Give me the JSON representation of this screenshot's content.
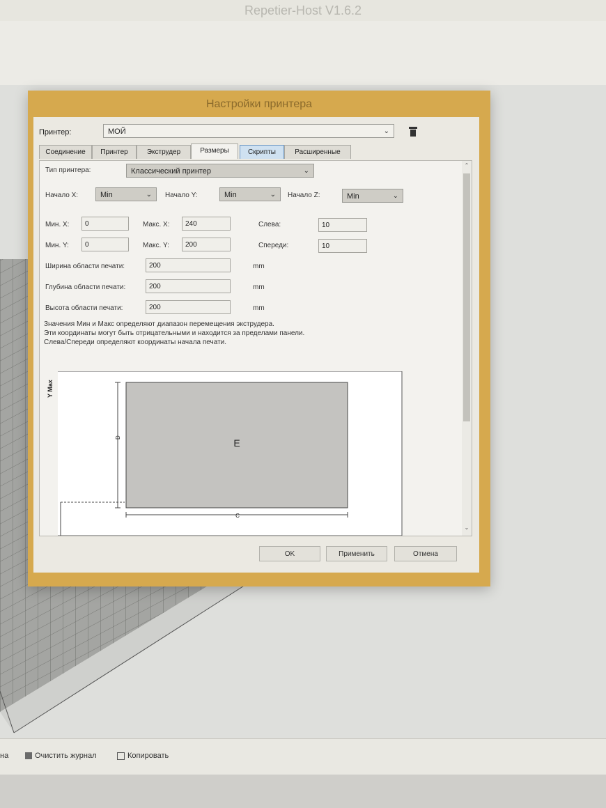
{
  "app": {
    "title": "Repetier-Host V1.6.2"
  },
  "dialog": {
    "title": "Настройки принтера",
    "printer_label": "Принтер:",
    "printer_value": "МОЙ",
    "tabs": [
      "Соединение",
      "Принтер",
      "Экструдер",
      "Размеры",
      "Скрипты",
      "Расширенные"
    ],
    "active_tab": "Размеры",
    "printer_type_label": "Тип принтера:",
    "printer_type_value": "Классический принтер",
    "start_x_label": "Начало X:",
    "start_x_value": "Min",
    "start_y_label": "Начало Y:",
    "start_y_value": "Min",
    "start_z_label": "Начало Z:",
    "start_z_value": "Min",
    "min_x_label": "Мин. X:",
    "min_x_value": "0",
    "max_x_label": "Макс. X:",
    "max_x_value": "240",
    "left_label": "Слева:",
    "left_value": "10",
    "min_y_label": "Мин. Y:",
    "min_y_value": "0",
    "max_y_label": "Макс. Y:",
    "max_y_value": "200",
    "front_label": "Спереди:",
    "front_value": "10",
    "width_label": "Ширина области печати:",
    "width_value": "200",
    "depth_label": "Глубина области печати:",
    "depth_value": "200",
    "height_label": "Высота области печати:",
    "height_value": "200",
    "unit": "mm",
    "note_lines": [
      "Значения Мин и Макс определяют диапазон перемещения экструдера.",
      "Эти координаты могут быть отрицательными и находится за пределами панели.",
      "Слева/Спереди определяют координаты начала печати."
    ],
    "diagram": {
      "y_axis_label": "Y Max",
      "area_label": "E",
      "depth_mark": "D",
      "width_mark": "C"
    },
    "ok_label": "OK",
    "apply_label": "Применить",
    "cancel_label": "Отмена"
  },
  "log_bar": {
    "left_fragment": "на",
    "clear_label": "Очистить журнал",
    "copy_label": "Копировать"
  },
  "colors": {
    "dialog_frame": "#d6a94e",
    "tab_hover": "#cfe1f1",
    "print_area": "#c4c3c0"
  }
}
